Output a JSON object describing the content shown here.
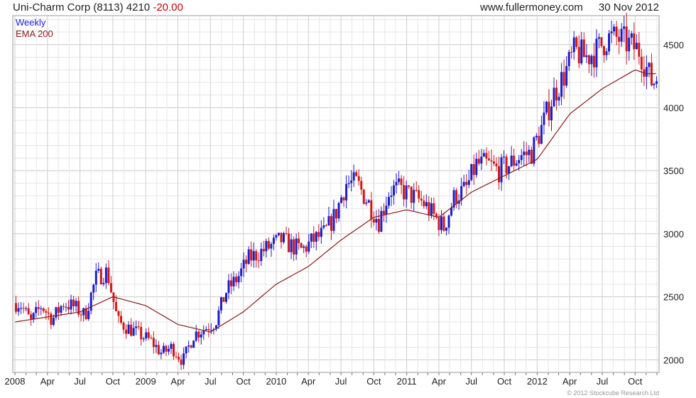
{
  "header": {
    "security": "Uni-Charm Corp (8113)",
    "price": "4210",
    "change": "-20.00",
    "website": "www.fullermoney.com",
    "date": "30 Nov 2012"
  },
  "copyright": "© 2012 Stockcube Research Ltd",
  "colors": {
    "up": "#1c1ccc",
    "down": "#d01818",
    "ema": "#8b1a1a",
    "grid": "#d4d4d4",
    "legend_weekly": "#1c1ccc",
    "legend_ema": "#8b1a1a"
  },
  "chart_data": {
    "type": "candlestick",
    "legend": [
      {
        "label": "Weekly"
      },
      {
        "label": "EMA 200"
      }
    ],
    "y_ticks": [
      2000,
      2500,
      3000,
      3500,
      4000,
      4500
    ],
    "ylim": [
      1900,
      4730
    ],
    "x_tick_labels": [
      "2008",
      "Apr",
      "Jul",
      "Oct",
      "2009",
      "Apr",
      "Jul",
      "Oct",
      "2010",
      "Apr",
      "Jul",
      "Oct",
      "2011",
      "Apr",
      "Jul",
      "Oct",
      "2012",
      "Apr",
      "Jul",
      "Oct"
    ],
    "x_tick_dates": [
      "2008-01",
      "2008-04",
      "2008-07",
      "2008-10",
      "2009-01",
      "2009-04",
      "2009-07",
      "2009-10",
      "2010-01",
      "2010-04",
      "2010-07",
      "2010-10",
      "2011-01",
      "2011-04",
      "2011-07",
      "2011-10",
      "2012-01",
      "2012-04",
      "2012-07",
      "2012-10"
    ],
    "grid": true,
    "approx_weekly_closes": [
      [
        "2008-01",
        2450
      ],
      [
        "2008-02",
        2300
      ],
      [
        "2008-03",
        2430
      ],
      [
        "2008-04",
        2320
      ],
      [
        "2008-05",
        2450
      ],
      [
        "2008-06",
        2420
      ],
      [
        "2008-07",
        2350
      ],
      [
        "2008-08",
        2650
      ],
      [
        "2008-09",
        2700
      ],
      [
        "2008-10",
        2300
      ],
      [
        "2008-11",
        2250
      ],
      [
        "2008-12",
        2200
      ],
      [
        "2009-01",
        2150
      ],
      [
        "2009-02",
        2050
      ],
      [
        "2009-03",
        2100
      ],
      [
        "2009-04",
        1990
      ],
      [
        "2009-05",
        2200
      ],
      [
        "2009-06",
        2250
      ],
      [
        "2009-07",
        2300
      ],
      [
        "2009-08",
        2550
      ],
      [
        "2009-09",
        2650
      ],
      [
        "2009-10",
        2800
      ],
      [
        "2009-11",
        2850
      ],
      [
        "2009-12",
        2900
      ],
      [
        "2010-01",
        2950
      ],
      [
        "2010-02",
        2900
      ],
      [
        "2010-03",
        2870
      ],
      [
        "2010-04",
        2950
      ],
      [
        "2010-05",
        3000
      ],
      [
        "2010-06",
        3150
      ],
      [
        "2010-07",
        3400
      ],
      [
        "2010-08",
        3400
      ],
      [
        "2010-09",
        3250
      ],
      [
        "2010-10",
        3100
      ],
      [
        "2010-11",
        3350
      ],
      [
        "2010-12",
        3350
      ],
      [
        "2011-01",
        3300
      ],
      [
        "2011-02",
        3250
      ],
      [
        "2011-03",
        3150
      ],
      [
        "2011-04",
        3050
      ],
      [
        "2011-05",
        3300
      ],
      [
        "2011-06",
        3350
      ],
      [
        "2011-07",
        3550
      ],
      [
        "2011-08",
        3550
      ],
      [
        "2011-09",
        3500
      ],
      [
        "2011-10",
        3550
      ],
      [
        "2011-11",
        3620
      ],
      [
        "2011-12",
        3640
      ],
      [
        "2012-01",
        3850
      ],
      [
        "2012-02",
        4100
      ],
      [
        "2012-03",
        4250
      ],
      [
        "2012-04",
        4450
      ],
      [
        "2012-05",
        4400
      ],
      [
        "2012-06",
        4450
      ],
      [
        "2012-07",
        4550
      ],
      [
        "2012-08",
        4550
      ],
      [
        "2012-09",
        4500
      ],
      [
        "2012-10",
        4450
      ],
      [
        "2012-11",
        4210
      ]
    ],
    "approx_ema200": [
      [
        "2008-01",
        2300
      ],
      [
        "2008-07",
        2380
      ],
      [
        "2008-10",
        2500
      ],
      [
        "2009-01",
        2430
      ],
      [
        "2009-04",
        2280
      ],
      [
        "2009-07",
        2220
      ],
      [
        "2009-10",
        2380
      ],
      [
        "2010-01",
        2600
      ],
      [
        "2010-04",
        2740
      ],
      [
        "2010-07",
        2950
      ],
      [
        "2010-10",
        3130
      ],
      [
        "2011-01",
        3190
      ],
      [
        "2011-04",
        3130
      ],
      [
        "2011-07",
        3330
      ],
      [
        "2011-10",
        3460
      ],
      [
        "2012-01",
        3590
      ],
      [
        "2012-04",
        3950
      ],
      [
        "2012-07",
        4150
      ],
      [
        "2012-10",
        4300
      ],
      [
        "2012-11",
        4270
      ]
    ]
  }
}
